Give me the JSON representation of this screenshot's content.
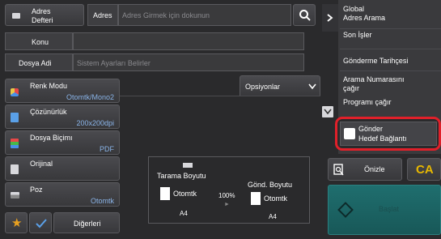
{
  "address_book": {
    "line1": "Adres",
    "line2": "Defteri"
  },
  "address": {
    "label": "Adres",
    "placeholder": "Adres Girmek için dokunun"
  },
  "subject": {
    "label": "Konu"
  },
  "filename": {
    "label": "Dosya Adi",
    "value": "Sistem Ayarları Belirler"
  },
  "options_label": "Opsiyonlar",
  "settings": [
    {
      "title": "Renk Modu",
      "value": "Otomtk/Mono2"
    },
    {
      "title": "Çözünürlük",
      "value": "200x200dpi"
    },
    {
      "title": "Dosya Biçimı",
      "value": "PDF"
    },
    {
      "title": "Orijinal",
      "value": ""
    },
    {
      "title": "Poz",
      "value": "Otomtk"
    }
  ],
  "others_label": "Diğerleri",
  "preview_panel": {
    "scan_size_label": "Tarama Boyutu",
    "scan_size_value": "Otomtk",
    "scan_paper": "A4",
    "ratio": "100%",
    "send_size_label": "Gönd. Boyutu",
    "send_size_value": "Otomtk",
    "send_paper": "A4"
  },
  "sidebar": {
    "items": [
      {
        "line1": "Global",
        "line2": "Adres Arama"
      },
      {
        "line1": "Son İşler",
        "line2": ""
      },
      {
        "line1": "Gönderme Tarihçesi",
        "line2": ""
      },
      {
        "line1": "Arama Numarasını",
        "line2": "çağır"
      },
      {
        "line1": "Programı çağır",
        "line2": ""
      }
    ],
    "link_send": {
      "line1": "Gönder",
      "line2": "Hedef Bağlantı"
    }
  },
  "preview_label": "Önizle",
  "ca_label": "CA",
  "start_label": "Başlat",
  "colors": {
    "accent_blue": "#8ab4e8",
    "highlight_red": "#e0202a",
    "ca_yellow": "#e8b800",
    "start_teal": "#1f6e6e"
  }
}
